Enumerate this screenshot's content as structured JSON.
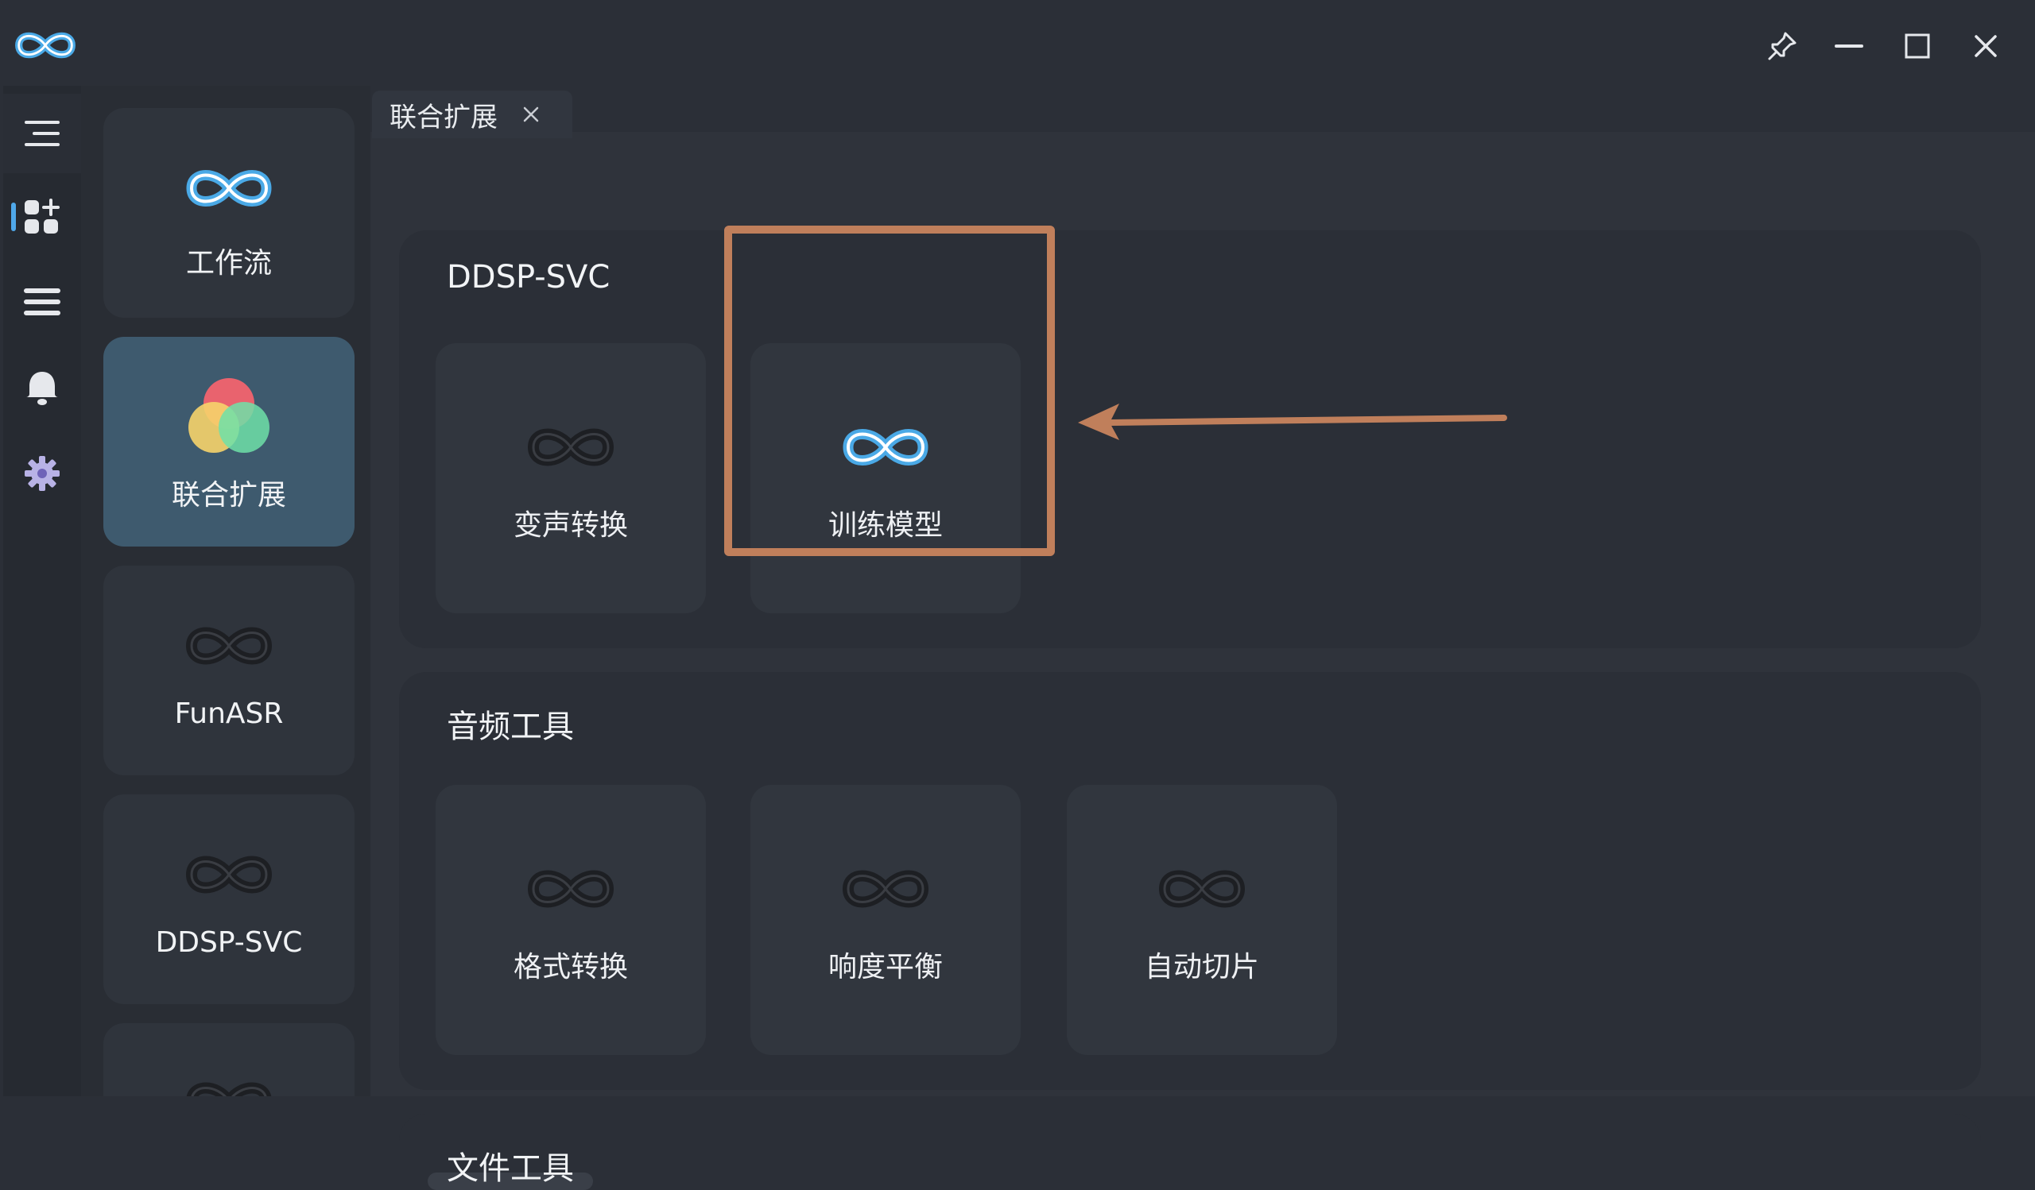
{
  "window": {
    "logo_icon": "infinity-logo",
    "controls": [
      "pin-icon",
      "minimize-icon",
      "maximize-icon",
      "close-icon"
    ]
  },
  "rail": {
    "items": [
      "menu-icon",
      "apps-icon",
      "list-icon",
      "bell-icon",
      "gear-icon"
    ],
    "active_index": 1
  },
  "nav": {
    "items": [
      {
        "label": "工作流",
        "icon": "infinity-blue-icon"
      },
      {
        "label": "联合扩展",
        "icon": "color-circles-icon",
        "active": true
      },
      {
        "label": "FunASR",
        "icon": "infinity-dark-icon"
      },
      {
        "label": "DDSP-SVC",
        "icon": "infinity-dark-icon"
      }
    ]
  },
  "tab": {
    "label": "联合扩展"
  },
  "sections": [
    {
      "title": "DDSP-SVC",
      "tools": [
        {
          "label": "变声转换"
        },
        {
          "label": "训练模型"
        }
      ]
    },
    {
      "title": "音频工具",
      "tools": [
        {
          "label": "格式转换"
        },
        {
          "label": "响度平衡"
        },
        {
          "label": "自动切片"
        }
      ]
    },
    {
      "title": "文件工具",
      "tools": []
    }
  ],
  "colors": {
    "accent_blue": "#4fa8ea",
    "highlight_box": "#c07f5b",
    "active_nav": "#3e5a6e"
  }
}
